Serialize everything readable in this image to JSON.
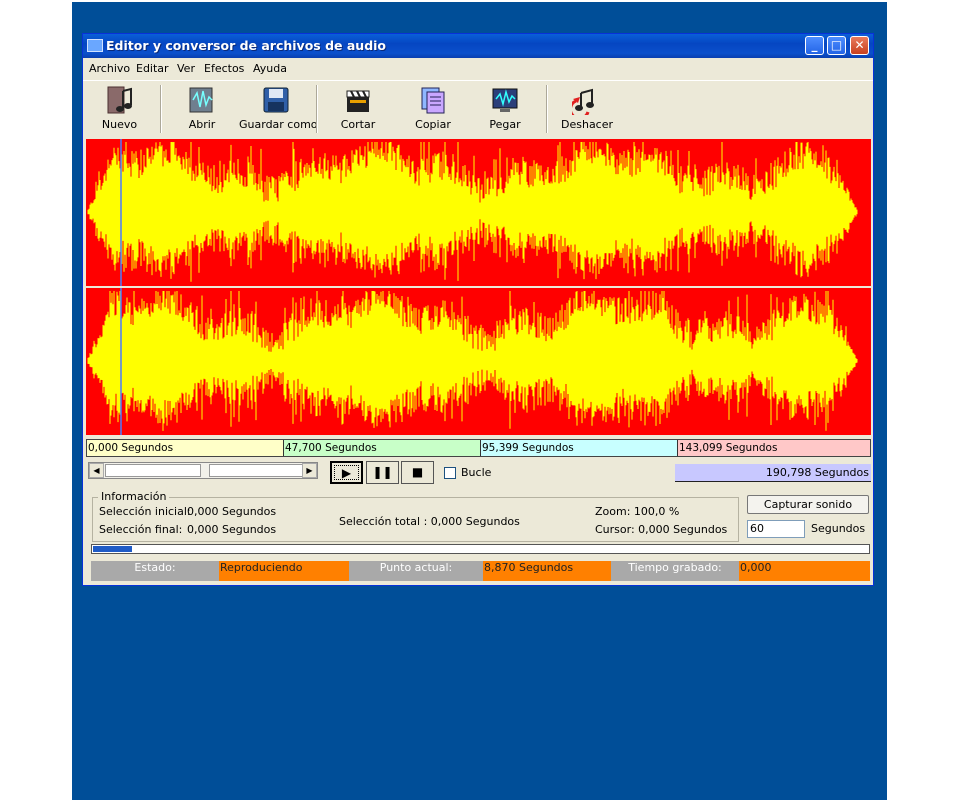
{
  "window": {
    "title": "Editor y conversor de archivos de audio",
    "min_label": "_",
    "max_label": "□",
    "close_label": "✕"
  },
  "menu": [
    "Archivo",
    "Editar",
    "Ver",
    "Efectos",
    "Ayuda"
  ],
  "toolbar": {
    "new_label": "Nuevo",
    "open_label": "Abrir",
    "save_as_label": "Guardar como",
    "cut_label": "Cortar",
    "copy_label": "Copiar",
    "paste_label": "Pegar",
    "undo_label": "Deshacer"
  },
  "waveform": {
    "background": "#ff0000",
    "wave_color": "#ffff00",
    "cursor_color": "#4a7cff"
  },
  "time_ruler": [
    "0,000 Segundos",
    "47,700 Segundos",
    "95,399 Segundos",
    "143,099 Segundos"
  ],
  "total_time": "190,798 Segundos",
  "playback": {
    "play": "▶",
    "pause": "❚❚",
    "stop": "■",
    "loop_label": "Bucle"
  },
  "info": {
    "legend": "Información",
    "start_sel_label": "Selección inicial:",
    "start_sel_value": "0,000 Segundos",
    "end_sel_label": "Selección final:",
    "end_sel_value": "0,000 Segundos",
    "total_sel": "Selección total : 0,000 Segundos",
    "zoom": "Zoom: 100,0 %",
    "cursor": "Cursor: 0,000 Segundos"
  },
  "capture": {
    "button_label": "Capturar sonido",
    "seconds_value": "60",
    "seconds_label": "Segundos"
  },
  "progress_fraction": 0.05,
  "status": {
    "state_label": "Estado:",
    "state_value": "Reproduciendo",
    "point_label": "Punto actual:",
    "point_value": "8,870 Segundos",
    "rec_label": "Tiempo grabado:",
    "rec_value": "0,000"
  }
}
